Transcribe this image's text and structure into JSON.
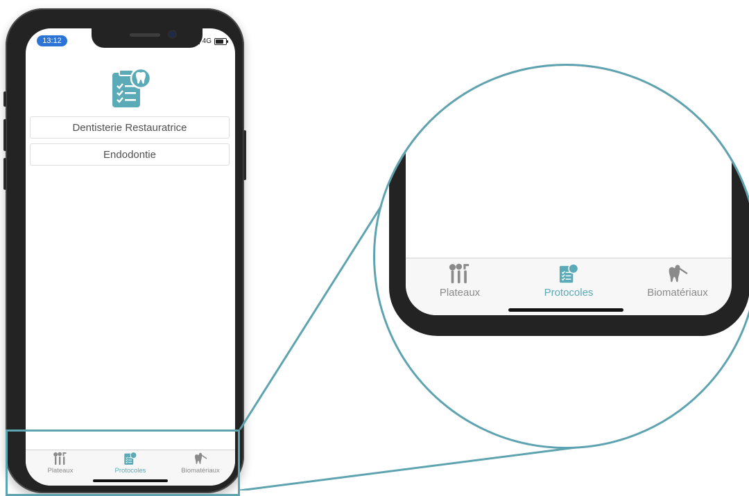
{
  "status": {
    "time": "13:12",
    "network": "4G"
  },
  "protocol_list": [
    {
      "label": "Dentisterie Restauratrice"
    },
    {
      "label": "Endodontie"
    }
  ],
  "tabs": [
    {
      "label": "Plateaux",
      "icon": "dental-instruments-icon",
      "active": false
    },
    {
      "label": "Protocoles",
      "icon": "checklist-tooth-icon",
      "active": true
    },
    {
      "label": "Biomatériaux",
      "icon": "tooth-tool-icon",
      "active": false
    }
  ],
  "colors": {
    "accent": "#5aaab7",
    "callout": "#5ea3b0",
    "inactive": "#8a8a8a",
    "time_pill": "#2c74d6"
  }
}
